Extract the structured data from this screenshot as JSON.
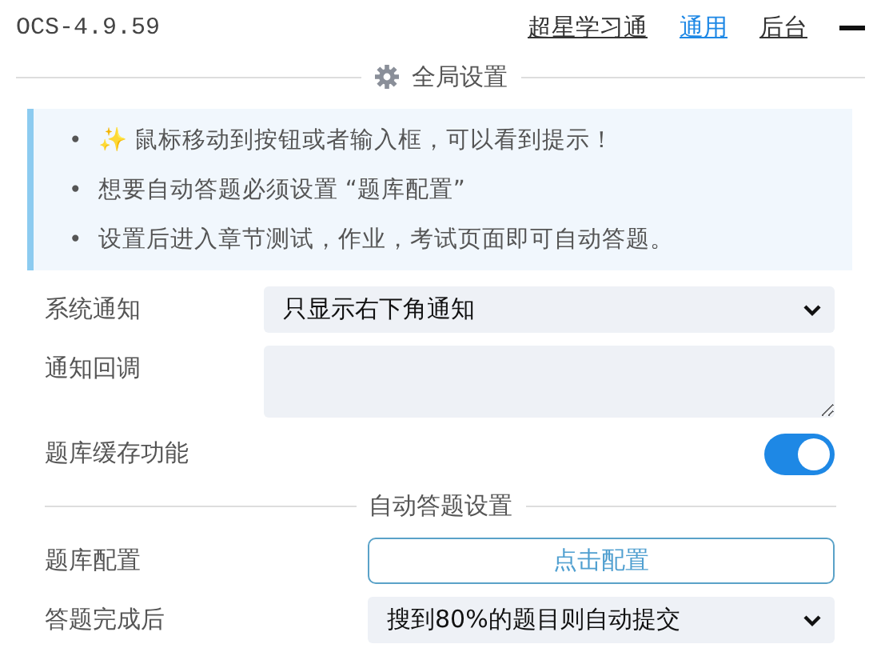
{
  "header": {
    "title": "OCS-4.9.59",
    "tabs": [
      {
        "label": "超星学习通",
        "selected": false
      },
      {
        "label": "通用",
        "selected": true
      },
      {
        "label": "后台",
        "selected": false
      }
    ]
  },
  "sections": [
    {
      "title": "全局设置",
      "icon": true,
      "tips": [
        {
          "bullet": "•",
          "text": "✨ 鼠标移动到按钮或者输入框，可以看到提示！"
        },
        {
          "bullet": "•",
          "text": "想要自动答题必须设置 “题库配置”"
        },
        {
          "bullet": "•",
          "text": "设置后进入章节测试，作业，考试页面即可自动答题。"
        }
      ],
      "rows": [
        {
          "kind": "select",
          "label": "系统通知",
          "value": "只显示右下角通知"
        },
        {
          "kind": "textarea",
          "label": "通知回调"
        },
        {
          "kind": "toggle",
          "label": "题库缓存功能",
          "on": true
        }
      ]
    },
    {
      "title": "自动答题设置",
      "icon": false,
      "rows": [
        {
          "kind": "button",
          "label": "题库配置",
          "value": "点击配置"
        },
        {
          "kind": "select",
          "label": "答题完成后",
          "value": "搜到80%的题目则自动提交"
        }
      ]
    }
  ]
}
